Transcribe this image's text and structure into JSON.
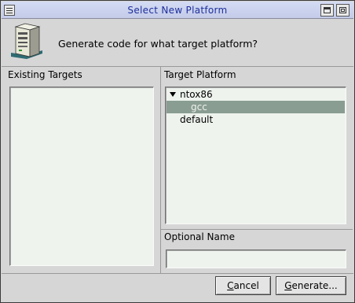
{
  "window": {
    "title": "Select New Platform"
  },
  "header": {
    "icon": "computer-tower-icon",
    "prompt": "Generate code for what target platform?"
  },
  "existing_targets": {
    "title": "Existing Targets",
    "items": []
  },
  "target_platform": {
    "title": "Target Platform",
    "tree": [
      {
        "label": "ntox86",
        "expanded": true,
        "children": [
          {
            "label": "gcc",
            "selected": true
          }
        ]
      },
      {
        "label": "default"
      }
    ]
  },
  "optional_name": {
    "title": "Optional Name",
    "value": ""
  },
  "buttons": {
    "cancel": {
      "mnemonic": "C",
      "rest": "ancel"
    },
    "generate": {
      "mnemonic": "G",
      "rest": "enerate..."
    }
  },
  "colors": {
    "title_text": "#1e2f9c",
    "selection": "#8a9d93",
    "list_bg": "#eef3ee"
  }
}
